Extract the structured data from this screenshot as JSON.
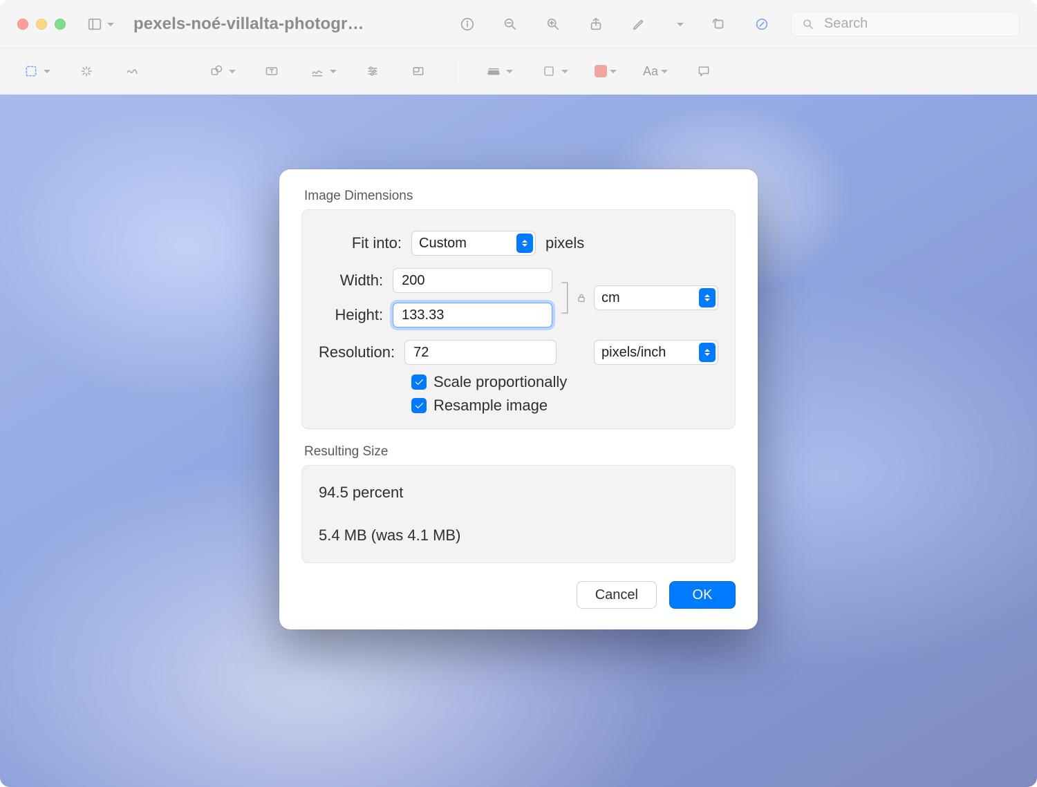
{
  "window": {
    "title": "pexels-noé-villalta-photogr…",
    "search_placeholder": "Search"
  },
  "dialog": {
    "image_dimensions_label": "Image Dimensions",
    "fit_into_label": "Fit into:",
    "fit_into_value": "Custom",
    "fit_into_unit": "pixels",
    "width_label": "Width:",
    "width_value": "200",
    "height_label": "Height:",
    "height_value": "133.33",
    "size_unit_value": "cm",
    "resolution_label": "Resolution:",
    "resolution_value": "72",
    "resolution_unit_value": "pixels/inch",
    "scale_proportionally_label": "Scale proportionally",
    "scale_proportionally_checked": true,
    "resample_image_label": "Resample image",
    "resample_image_checked": true,
    "resulting_size_label": "Resulting Size",
    "resulting_percent": "94.5 percent",
    "resulting_filesize": "5.4 MB (was 4.1 MB)",
    "cancel_label": "Cancel",
    "ok_label": "OK"
  }
}
